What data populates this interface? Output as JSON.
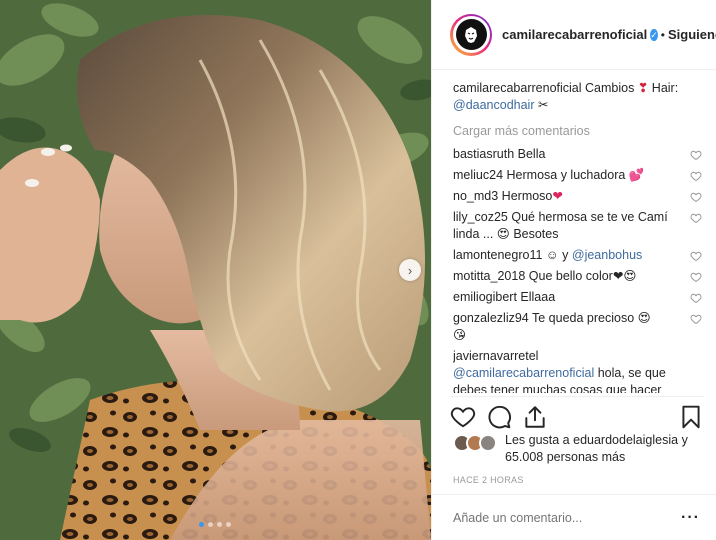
{
  "post": {
    "photo_alt": "",
    "carousel": {
      "count": 4,
      "active_index": 0
    }
  },
  "header": {
    "username": "camilarecabarrenoficial",
    "separator": "•",
    "follow_label": "Siguiendo",
    "verified_icon": "verified-badge-icon"
  },
  "caption": {
    "username": "camilarecabarrenoficial",
    "text_before": "Cambios",
    "emoji_1": "❣",
    "text_mid": "Hair:",
    "mention": "@daancodhair",
    "emoji_2": "✂"
  },
  "load_more_label": "Cargar más comentarios",
  "comments": [
    {
      "user": "bastiasruth",
      "text": "Bella",
      "emoji": ""
    },
    {
      "user": "meliuc24",
      "text": "Hermosa y luchadora",
      "emoji": "💕"
    },
    {
      "user": "no_md3",
      "text": "Hermoso",
      "emoji": "❤"
    },
    {
      "user": "lily_coz25",
      "text": "Qué hermosa se te ve Camí linda ...",
      "emoji": "😍",
      "text_after": "Besotes"
    },
    {
      "user": "lamontenegro11",
      "text": "☺ y",
      "mention": "@jeanbohus",
      "emoji": ""
    },
    {
      "user": "motitta_2018",
      "text": "Que bello color",
      "emoji": "❤😍"
    },
    {
      "user": "emiliogibert",
      "text": "Ellaaa",
      "emoji": ""
    },
    {
      "user": "gonzalezliz94",
      "text": "Te queda precioso",
      "emoji": "😍",
      "emoji_after": "😘"
    },
    {
      "user": "javiernavarretel",
      "mention": "@camilarecabarrenoficial",
      "text": "hola, se que debes tener muchas cosas que hacer",
      "emoji": ""
    }
  ],
  "likes": {
    "prefix": "Les gusta a",
    "user": "eduardodelaiglesia",
    "middle": "y",
    "count": "65.008 personas más"
  },
  "time_label": "HACE 2 HORAS",
  "add_comment_placeholder": "Añade un comentario...",
  "more_label": "···",
  "colors": {
    "link": "#3f6b9f",
    "accent": "#3897f0",
    "muted": "#999999",
    "text": "#262626",
    "border": "#efefef"
  }
}
